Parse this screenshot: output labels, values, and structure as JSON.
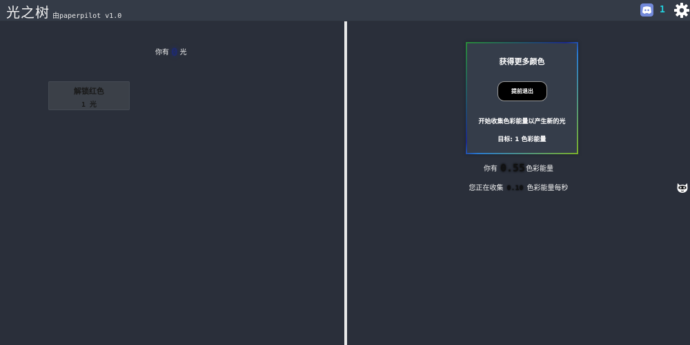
{
  "header": {
    "title": "光之树",
    "subtitle": "由paperpilot v1.0",
    "discord_icon": "discord-icon",
    "discord_count": "1",
    "settings_icon": "gear-icon",
    "accent_color": "#22d3e0"
  },
  "left": {
    "have_prefix": "你有",
    "have_amount": "0",
    "have_suffix": "光",
    "upgrade": {
      "title": "解锁红色",
      "cost": "1 光"
    }
  },
  "right": {
    "challenge": {
      "title": "获得更多颜色",
      "button_label": "提前退出",
      "description": "开始收集色彩能量以产生新的光",
      "goal": "目标: 1 色彩能量"
    },
    "energy": {
      "prefix": "你有",
      "amount": "0.55",
      "suffix": "色彩能量"
    },
    "rate": {
      "prefix": "您正在收集",
      "amount": "0.10",
      "suffix": "色彩能量每秒"
    },
    "mascot_icon": "cat-mascot-icon"
  }
}
